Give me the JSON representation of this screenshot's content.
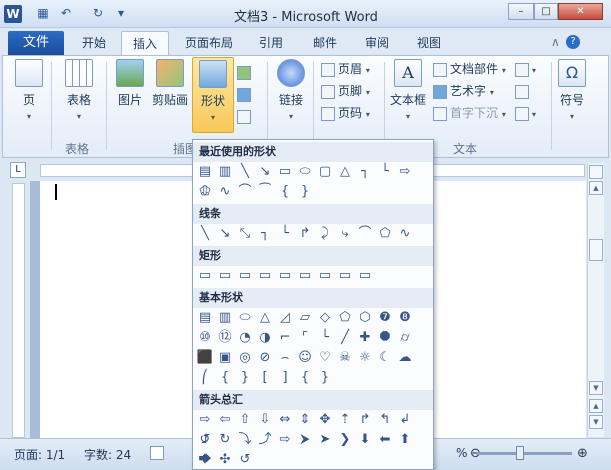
{
  "window": {
    "title": "文档3 - Microsoft Word",
    "word_icon": "W"
  },
  "qat": {
    "save_icon": "▦",
    "undo_icon": "↶",
    "redo_icon": "↻",
    "customize_icon": "▾"
  },
  "controls": {
    "minimize": "–",
    "maximize": "□",
    "close": "✕"
  },
  "tabs": {
    "file": "文件",
    "home": "开始",
    "insert": "插入",
    "layout": "页面布局",
    "references": "引用",
    "mailings": "邮件",
    "review": "审阅",
    "view": "视图"
  },
  "tab_right": {
    "collapse_icon": "∧",
    "help_icon": "?"
  },
  "ribbon": {
    "pages": "页",
    "table": "表格",
    "picture": "图片",
    "clipart": "剪贴画",
    "shapes": "形状",
    "link": "链接",
    "header": "页眉",
    "footer": "页脚",
    "page_number": "页码",
    "textbox": "文本框",
    "quick_parts": "文档部件",
    "wordart": "艺术字",
    "drop_cap": "首字下沉",
    "symbol": "符号",
    "groups": {
      "tables": "表格",
      "illustrations": "插图",
      "text": "文本"
    }
  },
  "shapes_panel": {
    "sections": [
      "最近使用的形状",
      "线条",
      "矩形",
      "基本形状",
      "箭头总汇"
    ],
    "recent": [
      "▤",
      "▥",
      "╲",
      "↘",
      "▭",
      "⬭",
      "▢",
      "△",
      "┐",
      "└",
      "⇨",
      "⇩"
    ],
    "recent2": [
      "⬠",
      "∿",
      "⌒",
      "⁀",
      "{",
      "}"
    ],
    "lines": [
      "╲",
      "↘",
      "⤡",
      "┐",
      "└",
      "↱",
      "⤸",
      "⤷",
      "⌒",
      "⬠",
      "∿"
    ],
    "rects": [
      "▭",
      "▭",
      "▭",
      "▭",
      "▭",
      "▭",
      "▭",
      "▭",
      "▭"
    ],
    "basic1": [
      "▤",
      "▥",
      "⬭",
      "△",
      "◿",
      "▱",
      "◇",
      "⬠",
      "⬡",
      "❼",
      "❽"
    ],
    "basic2": [
      "⑩",
      "⑫",
      "◔",
      "◑",
      "⌐",
      "⌜",
      "└",
      "╱",
      "✚",
      "⯃",
      "⌭"
    ],
    "basic3": [
      "⬛",
      "▣",
      "◎",
      "⊘",
      "⌢",
      "☺",
      "♡",
      "☠",
      "☼",
      "☾",
      "☁"
    ],
    "basic4": [
      "⎛",
      "{",
      "}",
      "[",
      "]",
      "{",
      "}"
    ],
    "arrows1": [
      "⇨",
      "⇦",
      "⇧",
      "⇩",
      "⇔",
      "⇕",
      "✥",
      "⇡",
      "↱",
      "↰",
      "↲",
      "⮥"
    ],
    "arrows2": [
      "↺",
      "↻",
      "⤵",
      "⤴",
      "⇨",
      "⮞",
      "➤",
      "❯",
      "⬇",
      "⬅",
      "⬆",
      "⮕"
    ],
    "arrows3": [
      "✥",
      "✣",
      "↺"
    ]
  },
  "statusbar": {
    "page": "页面: 1/1",
    "words": "字数: 24",
    "zoom_pct": "%",
    "zoom_minus": "⊖",
    "zoom_plus": "⊕"
  },
  "ruler": {
    "tab_selector": "L"
  }
}
